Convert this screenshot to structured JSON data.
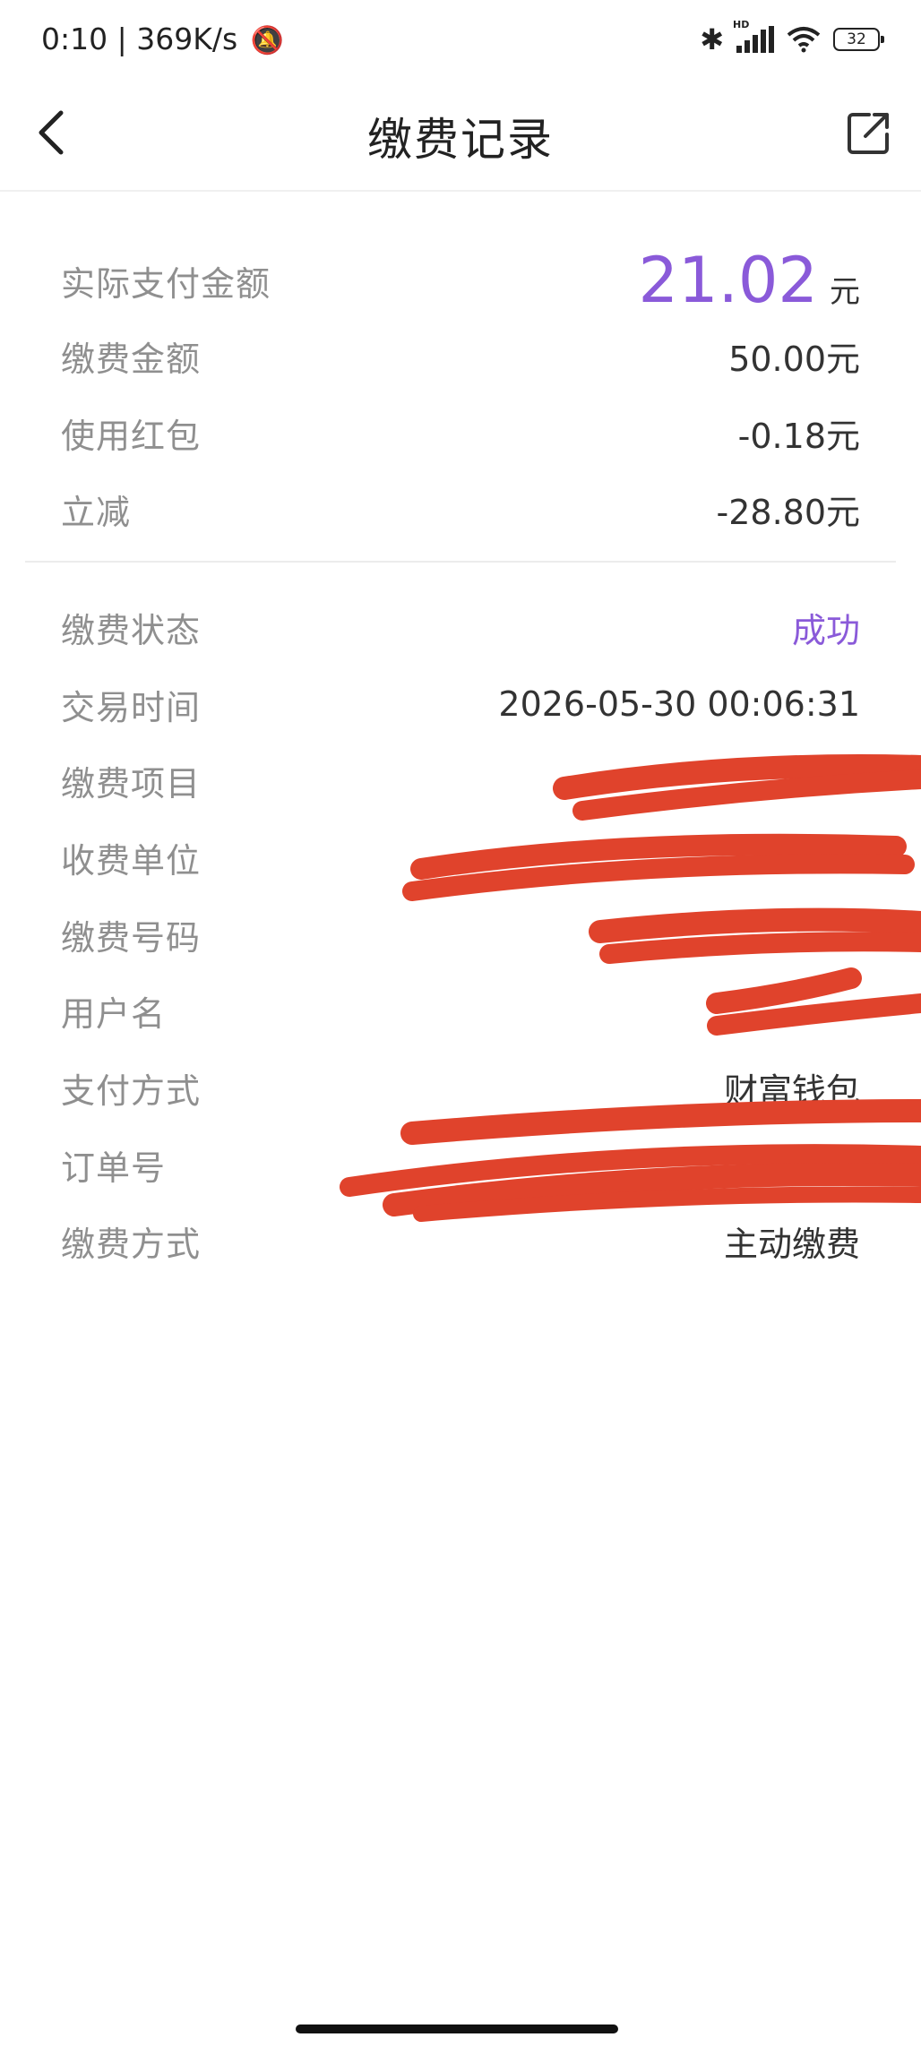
{
  "status_bar": {
    "time": "0:10",
    "net_speed": "369K/s",
    "battery": "32"
  },
  "header": {
    "title": "缴费记录"
  },
  "payment": {
    "actual_label": "实际支付金额",
    "actual_amount": "21.02",
    "actual_unit": "元",
    "fee_label": "缴费金额",
    "fee_value": "50.00元",
    "redpack_label": "使用红包",
    "redpack_value": "-0.18元",
    "discount_label": "立减",
    "discount_value": "-28.80元"
  },
  "details": {
    "status_label": "缴费状态",
    "status_value": "成功",
    "time_label": "交易时间",
    "time_value": "2026-05-30 00:06:31",
    "item_label": "缴费项目",
    "unit_label": "收费单位",
    "number_label": "缴费号码",
    "user_label": "用户名",
    "pay_method_label": "支付方式",
    "pay_method_value": "财富钱包",
    "order_label": "订单号",
    "mode_label": "缴费方式",
    "mode_value": "主动缴费"
  },
  "icons": {
    "back": "chevron-left-icon",
    "share": "share-icon",
    "bluetooth": "bluetooth-icon",
    "signal": "signal-icon",
    "wifi": "wifi-icon",
    "battery": "battery-icon",
    "bell_muted": "bell-muted-icon"
  },
  "colors": {
    "accent": "#8a5ad9",
    "redaction": "#e0432c"
  }
}
